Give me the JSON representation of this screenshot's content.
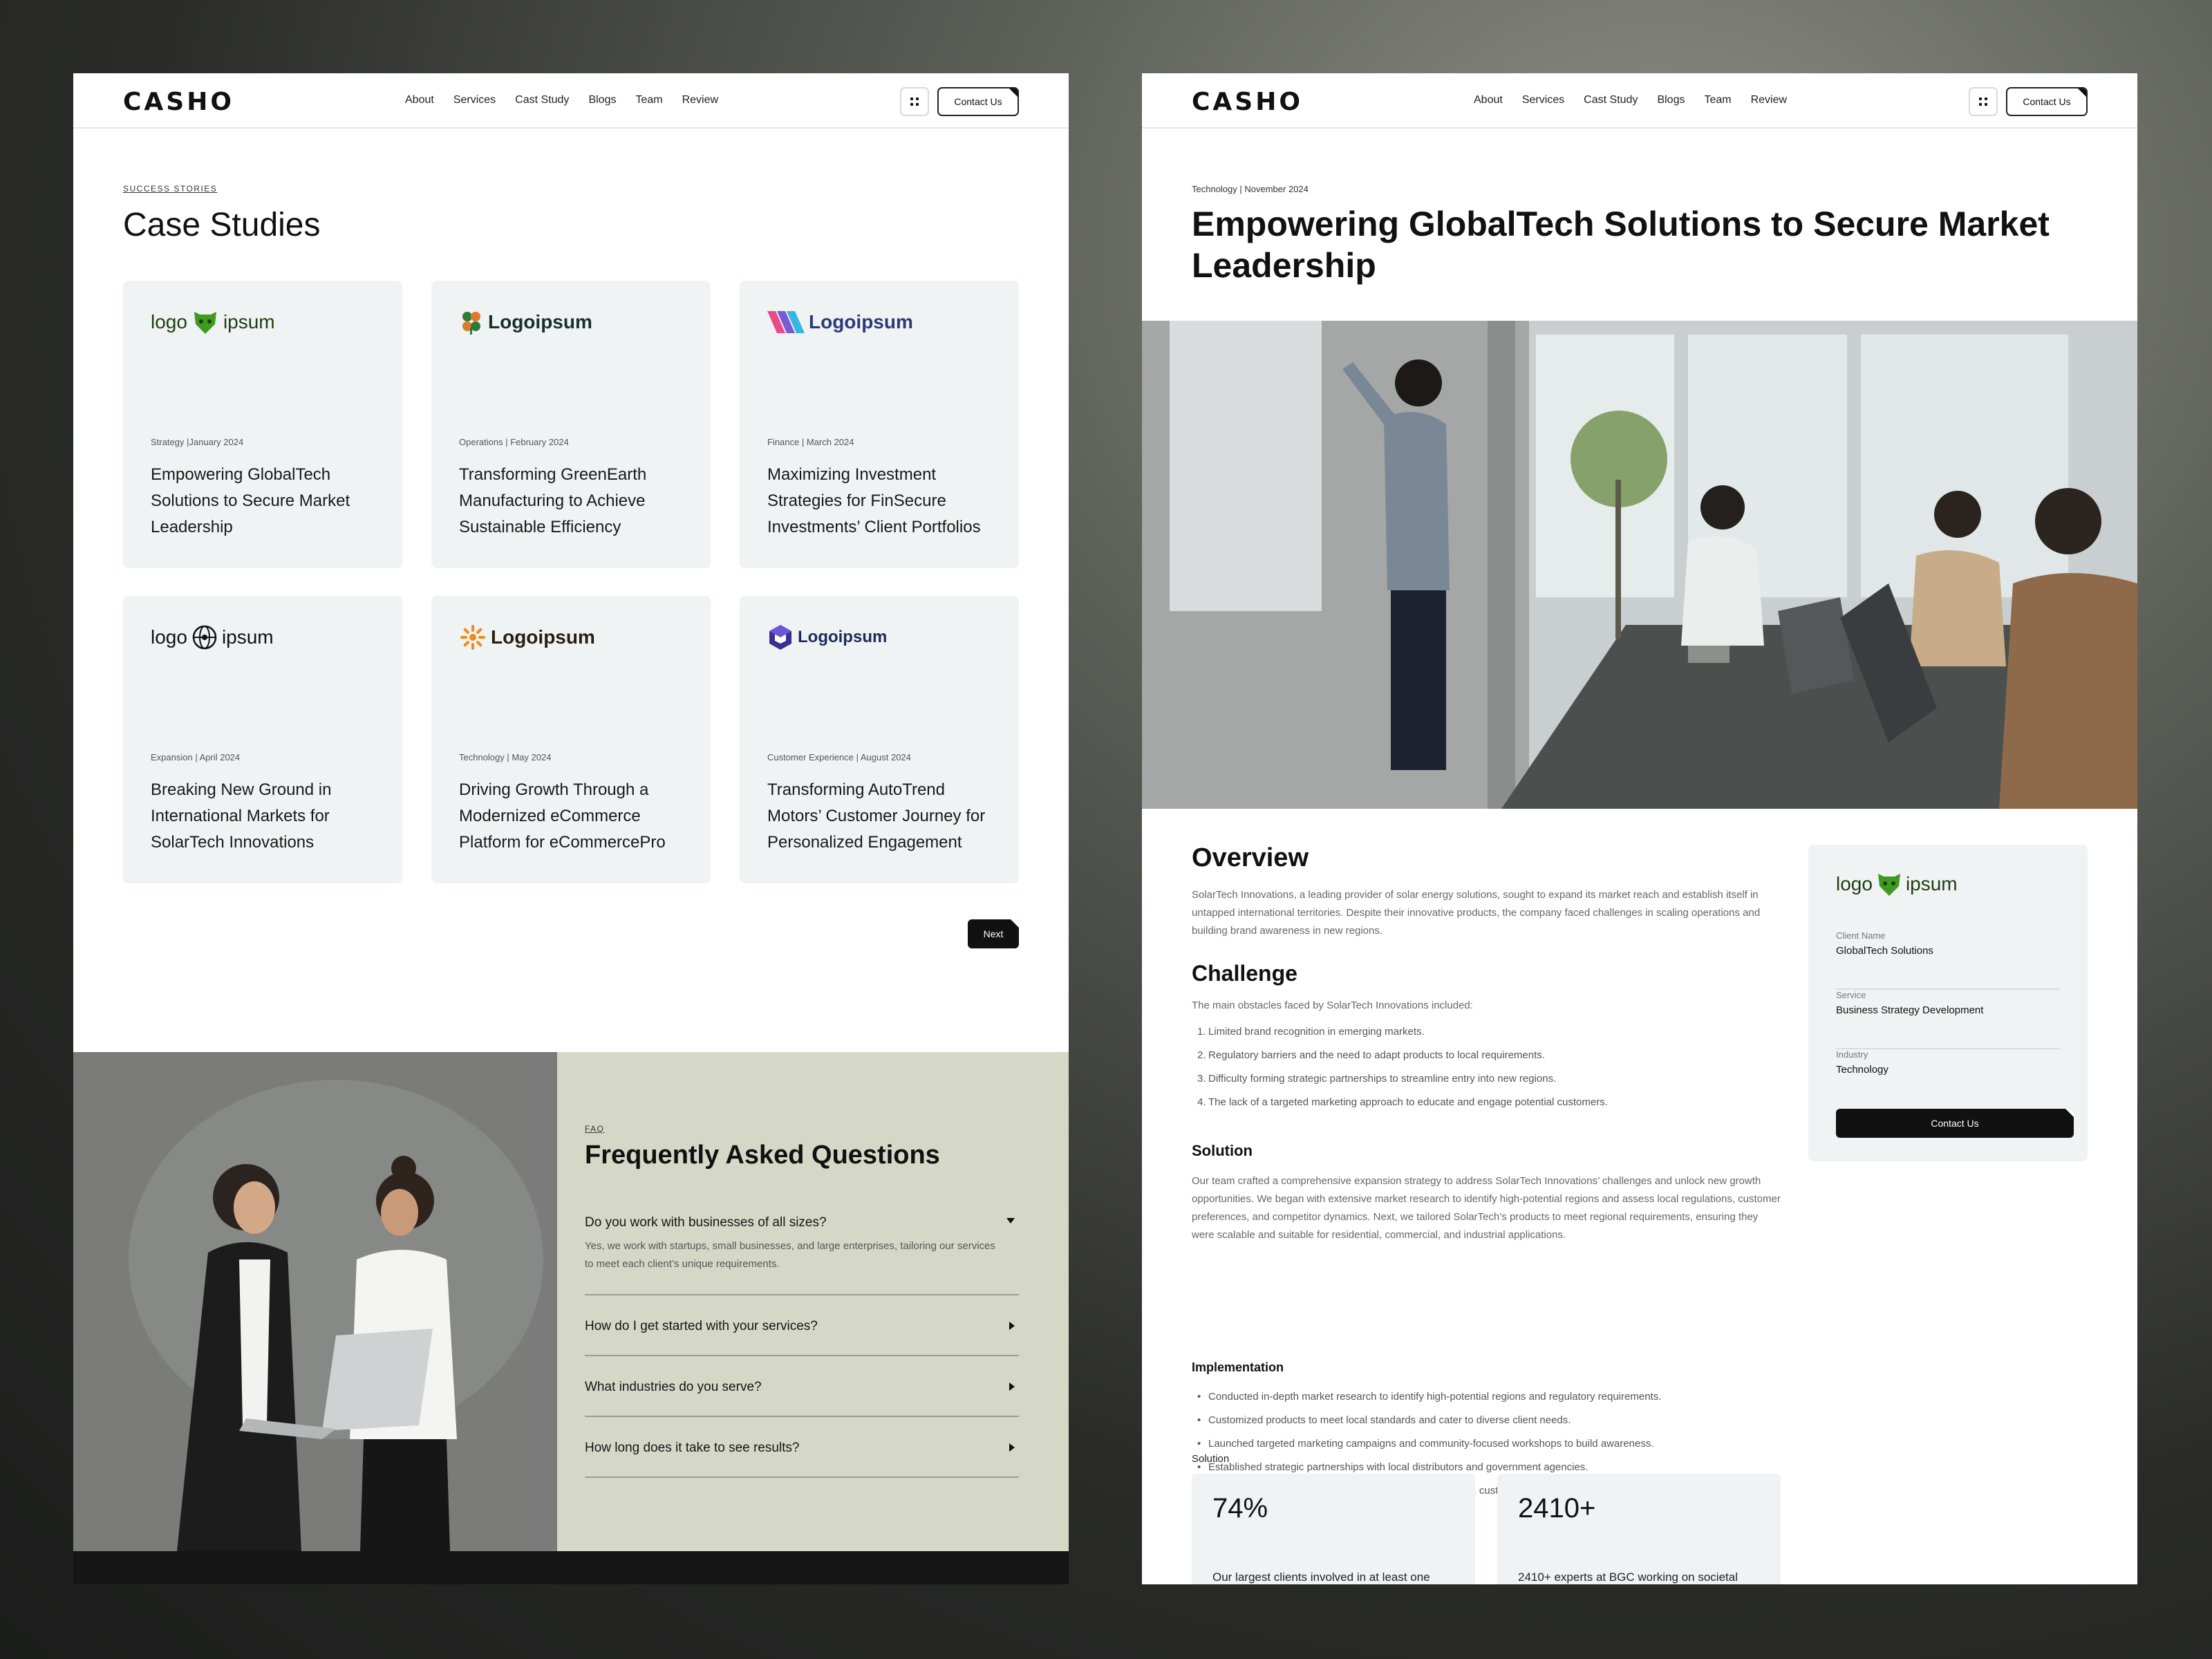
{
  "nav": {
    "brand": "CASHO",
    "items": [
      "About",
      "Services",
      "Cast Study",
      "Blogs",
      "Team",
      "Review"
    ],
    "contact_label": "Contact Us"
  },
  "case_studies": {
    "eyebrow": "SUCCESS STORIES",
    "title": "Case Studies",
    "cards": [
      {
        "logo_text": [
          "logo",
          "ipsum"
        ],
        "logo_icon": "bear-icon",
        "meta": "Strategy |January 2024",
        "title": "Empowering GlobalTech Solutions to Secure Market Leadership"
      },
      {
        "logo_text": [
          "Logoipsum"
        ],
        "logo_icon": "clover-icon",
        "meta": "Operations | February 2024",
        "title": "Transforming GreenEarth Manufacturing to Achieve Sustainable Efficiency"
      },
      {
        "logo_text": [
          "Logoipsum"
        ],
        "logo_icon": "stripes-icon",
        "meta": "Finance | March 2024",
        "title": "Maximizing Investment Strategies for FinSecure Investments’ Client Portfolios"
      },
      {
        "logo_text": [
          "logo",
          "ipsum"
        ],
        "logo_icon": "globe-icon",
        "meta": "Expansion | April 2024",
        "title": "Breaking New Ground in International Markets for SolarTech Innovations"
      },
      {
        "logo_text": [
          "Logoipsum"
        ],
        "logo_icon": "sunburst-icon",
        "meta": "Technology | May 2024",
        "title": "Driving Growth Through a Modernized eCommerce Platform for eCommercePro"
      },
      {
        "logo_text": [
          "Logoipsum"
        ],
        "logo_icon": "hexagon-icon",
        "meta": "Customer Experience | August 2024",
        "title": "Transforming AutoTrend Motors’ Customer Journey for Personalized Engagement"
      }
    ],
    "next_label": "Next"
  },
  "faq": {
    "eyebrow": "FAQ",
    "title": "Frequently Asked Questions",
    "items": [
      {
        "q": "Do you work with businesses of all sizes?",
        "a": "Yes, we work with startups, small businesses, and large enterprises, tailoring our services to meet each client’s unique requirements.",
        "open": true
      },
      {
        "q": "How do I get started with your services?",
        "open": false
      },
      {
        "q": "What industries do you serve?",
        "open": false
      },
      {
        "q": "How long does it take to see results?",
        "open": false
      }
    ]
  },
  "detail": {
    "meta": "Technology | November 2024",
    "title": "Empowering GlobalTech Solutions to Secure Market Leadership",
    "overview_heading": "Overview",
    "overview_text": "SolarTech Innovations, a leading provider of solar energy solutions, sought to expand its market reach and establish itself in untapped international territories. Despite their innovative products, the company faced challenges in scaling operations and building brand awareness in new regions.",
    "challenge_heading": "Challenge",
    "challenge_intro": "The main obstacles faced by SolarTech Innovations included:",
    "challenge_items": [
      "Limited brand recognition in emerging markets.",
      "Regulatory barriers and the need to adapt products to local requirements.",
      "Difficulty forming strategic partnerships to streamline entry into new regions.",
      "The lack of a targeted marketing approach to educate and engage potential customers."
    ],
    "solution_heading": "Solution",
    "solution_text": "Our team crafted a comprehensive expansion strategy to address SolarTech Innovations’ challenges and unlock new growth opportunities. We began with extensive market research to identify high-potential regions and assess local regulations, customer preferences, and competitor dynamics. Next, we tailored SolarTech’s products to meet regional requirements, ensuring they were scalable and suitable for residential, commercial, and industrial applications.",
    "implementation_heading": "Implementation",
    "implementation_items": [
      "Conducted in-depth market research to identify high-potential regions and regulatory requirements.",
      "Customized products to meet local standards and cater to diverse client needs.",
      "Launched targeted marketing campaigns and community-focused workshops to build awareness.",
      "Established strategic partnerships with local distributors and government agencies.",
      "Integrated advanced technologies for real-time monitoring, customer portals, and automation."
    ],
    "results_heading": "Solution",
    "stats": [
      {
        "value": "74%",
        "text": "Our largest clients involved in at least one"
      },
      {
        "value": "2410+",
        "text": "2410+ experts at BGC working on societal"
      }
    ],
    "sidebar": {
      "logo_text": [
        "logo",
        "ipsum"
      ],
      "client_label": "Client Name",
      "client_value": "GlobalTech Solutions",
      "service_label": "Service",
      "service_value": "Business Strategy Development",
      "industry_label": "Industry",
      "industry_value": "Technology",
      "button_label": "Contact Us"
    }
  },
  "colors": {
    "logo_green": "#3f9a1f",
    "logo_navy": "#2b3a7a",
    "faq_bg": "#d5d8c7",
    "card_bg": "#f0f3f3"
  }
}
